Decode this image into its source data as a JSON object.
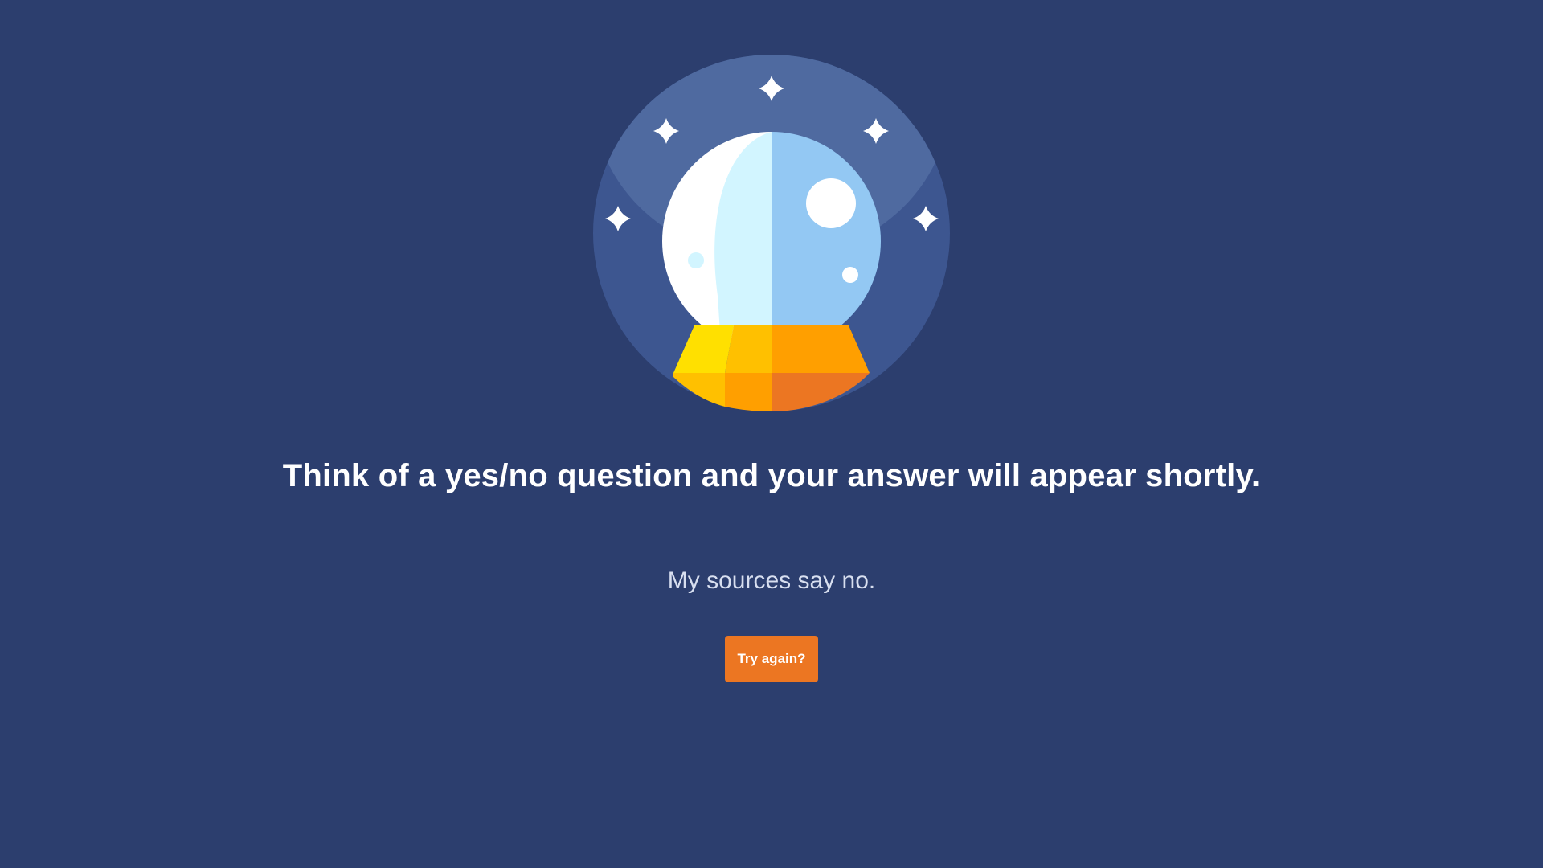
{
  "illustration": {
    "icon": "crystal-ball-icon",
    "colors": {
      "background": "#2c3e6e",
      "halo": "#4f6aa0",
      "orb_light": "#d2f5ff",
      "orb_blue": "#93c8f3",
      "base_yellow": "#ffe000",
      "base_orange": "#ff9f00",
      "base_dark_orange": "#ec7622"
    }
  },
  "headline": "Think of a yes/no question and your answer will appear shortly.",
  "answer": "My sources say no.",
  "button": {
    "label": "Try again?",
    "color": "#ec7622"
  }
}
